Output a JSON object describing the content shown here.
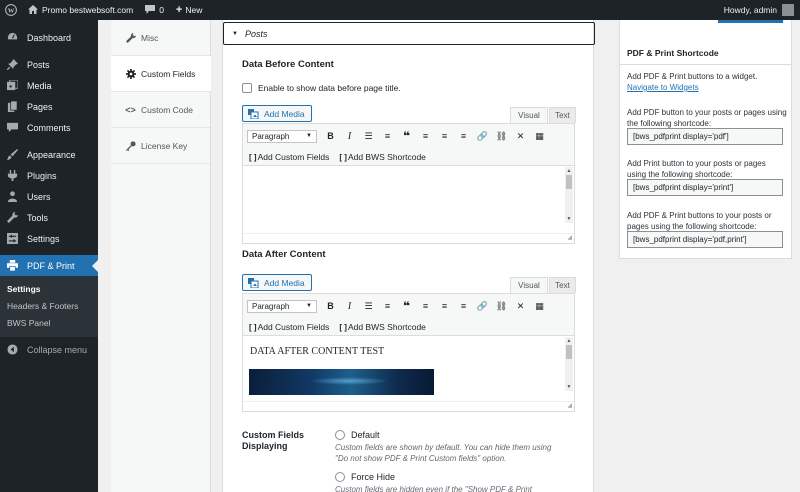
{
  "adminbar": {
    "site_name": "Promo bestwebsoft.com",
    "comments_count": "0",
    "new_label": "New",
    "howdy": "Howdy, admin"
  },
  "sidebar": {
    "items": [
      {
        "label": "Dashboard",
        "icon": "dashboard-icon"
      },
      {
        "label": "Posts",
        "icon": "pin-icon"
      },
      {
        "label": "Media",
        "icon": "media-icon"
      },
      {
        "label": "Pages",
        "icon": "pages-icon"
      },
      {
        "label": "Comments",
        "icon": "comments-icon"
      },
      {
        "label": "Appearance",
        "icon": "brush-icon"
      },
      {
        "label": "Plugins",
        "icon": "plug-icon"
      },
      {
        "label": "Users",
        "icon": "users-icon"
      },
      {
        "label": "Tools",
        "icon": "tools-icon"
      },
      {
        "label": "Settings",
        "icon": "settings-icon"
      },
      {
        "label": "PDF & Print",
        "icon": "print-icon"
      }
    ],
    "submenu": [
      "Settings",
      "Headers & Footers",
      "BWS Panel"
    ],
    "collapse_label": "Collapse menu"
  },
  "tabs": [
    {
      "label": "Misc",
      "icon": "wrench-icon"
    },
    {
      "label": "Custom Fields",
      "icon": "gear-icon"
    },
    {
      "label": "Custom Code",
      "icon": "code-icon"
    },
    {
      "label": "License Key",
      "icon": "key-icon"
    }
  ],
  "main": {
    "posts_header": "Posts",
    "before": {
      "title": "Data Before Content",
      "checkbox_label": "Enable to show data before page title.",
      "add_media": "Add Media",
      "visual": "Visual",
      "text": "Text",
      "format": "Paragraph",
      "custom_fields_btn": "Add Custom Fields",
      "bws_shortcode_btn": "Add BWS Shortcode"
    },
    "after": {
      "title": "Data After Content",
      "add_media": "Add Media",
      "visual": "Visual",
      "text": "Text",
      "format": "Paragraph",
      "custom_fields_btn": "Add Custom Fields",
      "bws_shortcode_btn": "Add BWS Shortcode",
      "content_text": "DATA AFTER CONTENT TEST"
    },
    "custom_fields": {
      "label": "Custom Fields Displaying",
      "option_default": "Default",
      "option_default_desc": "Custom fields are shown by default. You can hide them using \"Do not show PDF & Print Custom fields\" option.",
      "option_force": "Force Hide",
      "option_force_desc": "Custom fields are hidden even if the \"Show PDF & Print"
    }
  },
  "widget": {
    "title": "PDF & Print Shortcode",
    "text1": "Add PDF & Print buttons to a widget.",
    "link": "Navigate to Widgets",
    "text2": "Add PDF button to your posts or pages using the following shortcode:",
    "code1": "[bws_pdfprint display='pdf']",
    "text3": "Add Print button to your posts or pages using the following shortcode:",
    "code2": "[bws_pdfprint display='print']",
    "text4": "Add PDF & Print buttons to your posts or pages using the following shortcode:",
    "code3": "[bws_pdfprint display='pdf,print']"
  },
  "colors": {
    "admin_dark": "#1d2327",
    "accent": "#2271b1"
  }
}
